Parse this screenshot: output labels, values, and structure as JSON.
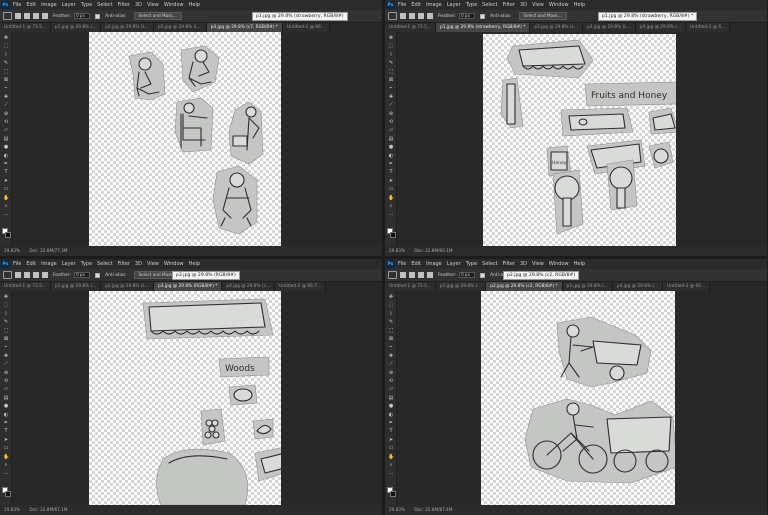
{
  "menu": [
    "File",
    "Edit",
    "Image",
    "Layer",
    "Type",
    "Select",
    "Filter",
    "3D",
    "View",
    "Window",
    "Help"
  ],
  "app_icon": "Ps",
  "options": {
    "feather_label": "Feather:",
    "feather_value": "0 px",
    "antialias_label": "Anti-alias",
    "select_mask": "Select and Mask..."
  },
  "panes": [
    {
      "tooltip": "p1.jpg @ 29.8% (strawberry, RGB/8#)",
      "tabs": [
        {
          "label": "Untitled-1 @ 73.5...",
          "active": false
        },
        {
          "label": "p1.jpg @ 29.8% (...",
          "active": false
        },
        {
          "label": "p2.jpg @ 29.8% (L...",
          "active": false
        },
        {
          "label": "p3.jpg @ 29.8% (L...",
          "active": false
        },
        {
          "label": "p4.jpg @ 29.8% (c7, RGB/8#) *",
          "active": true
        },
        {
          "label": "Untitled-2 @ 66...",
          "active": false
        }
      ],
      "status": {
        "zoom": "29.83%",
        "doc": "Doc: 22.8M/77.3M"
      }
    },
    {
      "tooltip": "p1.jpg @ 29.8% (strawberry, RGB/8#) *",
      "tabs": [
        {
          "label": "Untitled-1 @ 73.5...",
          "active": false
        },
        {
          "label": "p1.jpg @ 29.8% (strawberry, RGB/8#) *",
          "active": true
        },
        {
          "label": "p2.jpg @ 29.8% (L...",
          "active": false
        },
        {
          "label": "p3.jpg @ 29.8% (L...",
          "active": false
        },
        {
          "label": "p4.jpg @ 29.8% (...",
          "active": false
        },
        {
          "label": "Untitled-2 @ 6...",
          "active": false
        }
      ],
      "status": {
        "zoom": "29.83%",
        "doc": "Doc: 22.8M/93.1M"
      }
    },
    {
      "tooltip": "p3.jpg @ 29.8% (RGB/8#)",
      "tabs": [
        {
          "label": "Untitled-1 @ 73.5...",
          "active": false
        },
        {
          "label": "p1.jpg @ 29.8% (...",
          "active": false
        },
        {
          "label": "p2.jpg @ 29.8% (L...",
          "active": false
        },
        {
          "label": "p3.jpg @ 29.8% (RGB/8#) *",
          "active": true
        },
        {
          "label": "p4.jpg @ 29.8% (c...",
          "active": false
        },
        {
          "label": "Untitled-2 @ 66.7...",
          "active": false
        }
      ],
      "status": {
        "zoom": "29.83%",
        "doc": "Doc: 22.8M/67.1M"
      }
    },
    {
      "tooltip": "p2.jpg @ 29.8% (c2, RGB/8#)",
      "tabs": [
        {
          "label": "Untitled-1 @ 73.5...",
          "active": false
        },
        {
          "label": "p1.jpg @ 29.8% (...",
          "active": false
        },
        {
          "label": "p2.jpg @ 29.8% (c2, RGB/8#) *",
          "active": true
        },
        {
          "label": "p3.jpg @ 29.8% (...",
          "active": false
        },
        {
          "label": "p4.jpg @ 29.8% (...",
          "active": false
        },
        {
          "label": "Untitled-2 @ 66...",
          "active": false
        }
      ],
      "status": {
        "zoom": "29.83%",
        "doc": "Doc: 22.8M/87.4M"
      }
    }
  ],
  "artwork": {
    "fruits_label": "Fruits and Honey",
    "honey_label": "Honey",
    "woods_label": "Woods"
  },
  "colors": {
    "menubar": "#2b2b2b",
    "optionsbar": "#323232",
    "canvas": "#282828",
    "cutout": "#c3c6c2",
    "accent": "#31a8ff"
  }
}
